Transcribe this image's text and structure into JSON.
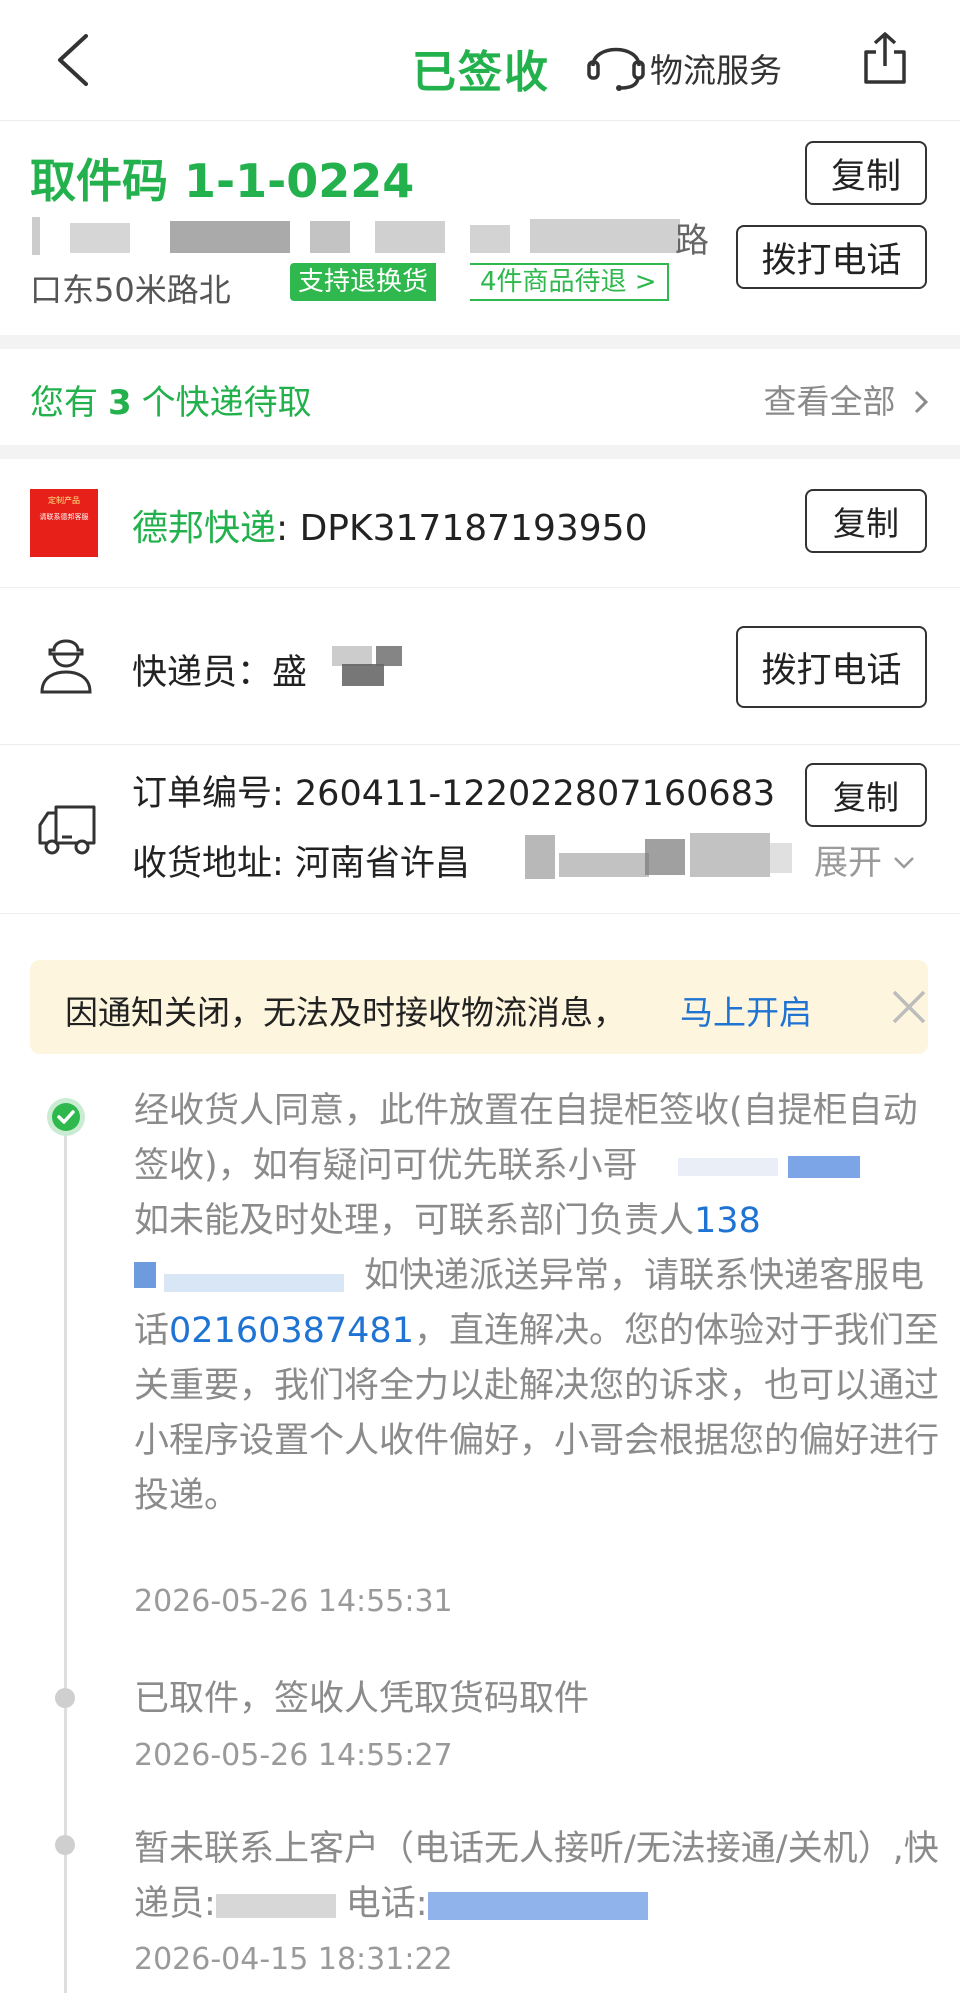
{
  "header": {
    "title": "已签收",
    "service_label": "物流服务"
  },
  "pickup": {
    "code_label": "取件码",
    "code_value": "1-1-0224",
    "copy_label": "复制",
    "call_label": "拨打电话",
    "address_line1_tail": "路",
    "address_line2": "口东50米路北",
    "tag_label": "支持退换货",
    "tag_right": "4件商品待退 >"
  },
  "pending": {
    "prefix": "您有",
    "count": "3",
    "suffix": "个快递待取",
    "view_all": "查看全部"
  },
  "courier_row": {
    "badge_lines": [
      "定制产品",
      "请联系德邦客服"
    ],
    "carrier": "德邦快递",
    "tracking": ": DPK317187193950",
    "copy_label": "复制"
  },
  "courier_person": {
    "label": "快递员：盛",
    "call_label": "拨打电话"
  },
  "order": {
    "order_label": "订单编号: 260411-122022807160683",
    "copy_label": "复制",
    "address_label": "收货地址: 河南省许昌",
    "expand_label": "展开"
  },
  "notice": {
    "text": "因通知关闭，无法及时接收物流消息，",
    "link": "马上开启"
  },
  "timeline": [
    {
      "text_a": "经收货人同意，此件放置在自提柜签收(自提柜自动签收)，如有疑问可优先联系小哥",
      "text_b": "如未能及时处理，可联系部门负责人",
      "phone_partial": "138",
      "text_c": "如快递派送异常，请联系快递客服电话",
      "service_phone": "02160387481",
      "text_d": "，直连解决。您的体验对于我们至关重要，我们将全力以赴解决您的诉求，也可以通过小程序设置个人收件偏好，小哥会根据您的偏好进行投递。",
      "time": "2026-05-26 14:55:31"
    },
    {
      "text": "已取件，签收人凭取货码取件",
      "time": "2026-05-26 14:55:27"
    },
    {
      "text_a": "暂未联系上客户（电话无人接听/无法接通/关机）,快递员:",
      "text_b": "电话:",
      "time": "2026-04-15 18:31:22"
    }
  ],
  "colors": {
    "brand_green": "#22b14c",
    "link_blue": "#1f73d3",
    "notice_bg": "#fdf5dd"
  }
}
